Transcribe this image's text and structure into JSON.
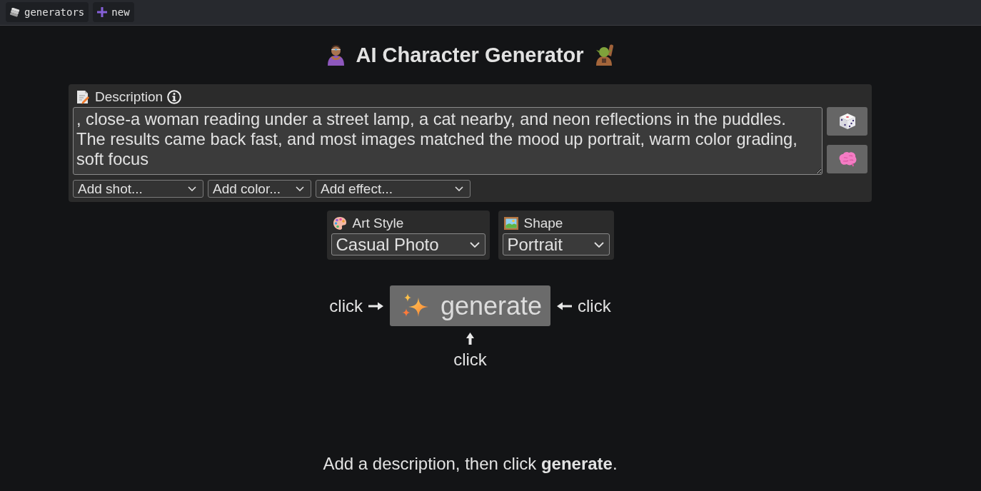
{
  "top_bar": {
    "items": [
      {
        "label": "generators"
      },
      {
        "label": "new"
      }
    ]
  },
  "title": "AI Character Generator",
  "description": {
    "label": "Description",
    "value": ", close-a woman reading under a street lamp, a cat nearby, and neon reflections in the puddles. The results came back fast, and most images matched the mood up portrait, warm color grading, soft focus",
    "dropdowns": [
      {
        "value": "Add shot..."
      },
      {
        "value": "Add color..."
      },
      {
        "value": "Add effect..."
      }
    ]
  },
  "settings": [
    {
      "label": "Art Style",
      "value": "Casual Photo"
    },
    {
      "label": "Shape",
      "value": "Portrait"
    }
  ],
  "generate": {
    "label": "generate",
    "hints": [
      "click",
      "click",
      "click"
    ]
  },
  "hint": "Add a description, then click **generate**."
}
